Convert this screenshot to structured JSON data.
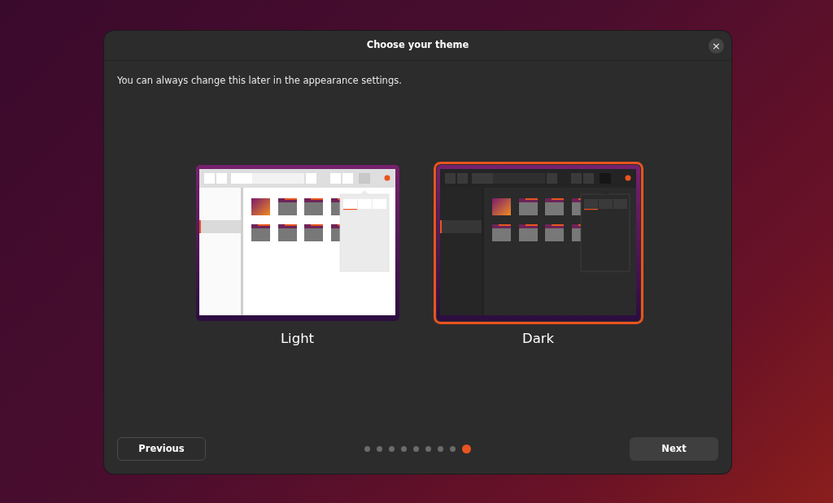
{
  "dialog": {
    "title": "Choose your theme",
    "close": "×",
    "subtitle": "You can always change this later in the appearance settings."
  },
  "themes": [
    {
      "kind": "light",
      "label": "Light",
      "selected": false
    },
    {
      "kind": "dark",
      "label": "Dark",
      "selected": true
    }
  ],
  "pages": [
    {
      "selected": false
    },
    {
      "selected": false
    },
    {
      "selected": false
    },
    {
      "selected": false
    },
    {
      "selected": false
    },
    {
      "selected": false
    },
    {
      "selected": false
    },
    {
      "selected": false
    },
    {
      "selected": true
    }
  ],
  "buttons": {
    "previous": "Previous",
    "next": "Next"
  }
}
